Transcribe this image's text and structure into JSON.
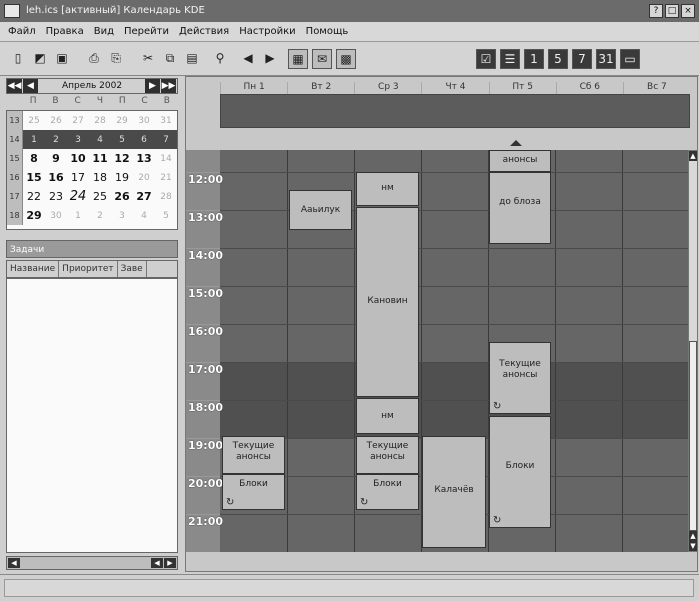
{
  "window": {
    "title": "leh.ics [активный]   Календарь KDE",
    "controls": [
      "?",
      "□",
      "×"
    ]
  },
  "menu": [
    "Файл",
    "Правка",
    "Вид",
    "Перейти",
    "Действия",
    "Настройки",
    "Помощь"
  ],
  "toolbar": {
    "icons": [
      "new-icon",
      "open-icon",
      "save-icon",
      "print-icon",
      "print-preview-icon",
      "cut-icon",
      "copy-icon",
      "paste-icon",
      "find-icon",
      "back-icon",
      "forward-icon",
      "today-icon",
      "mail-icon",
      "calendar-icon",
      "todo-view-icon",
      "list-view-icon",
      "day-view-icon",
      "week-view-icon",
      "week7-view-icon",
      "month-view-icon",
      "journal-view-icon"
    ]
  },
  "navigator": {
    "month": "Апрель 2002",
    "weekdays": [
      "П",
      "В",
      "С",
      "Ч",
      "П",
      "С",
      "В"
    ],
    "weeks": [
      {
        "num": "13",
        "days": [
          "25",
          "26",
          "27",
          "28",
          "29",
          "30",
          "31"
        ]
      },
      {
        "num": "14",
        "days": [
          "1",
          "2",
          "3",
          "4",
          "5",
          "6",
          "7"
        ]
      },
      {
        "num": "15",
        "days": [
          "8",
          "9",
          "10",
          "11",
          "12",
          "13",
          "14"
        ]
      },
      {
        "num": "16",
        "days": [
          "15",
          "16",
          "17",
          "18",
          "19",
          "20",
          "21"
        ]
      },
      {
        "num": "17",
        "days": [
          "22",
          "23",
          "24",
          "25",
          "26",
          "27",
          "28"
        ]
      },
      {
        "num": "18",
        "days": [
          "29",
          "30",
          "1",
          "2",
          "3",
          "4",
          "5"
        ]
      }
    ]
  },
  "tasks": {
    "header": "Задачи",
    "columns": [
      "Название",
      "Приоритет",
      "Заве"
    ]
  },
  "agenda": {
    "days": [
      "Пн 1",
      "Вт 2",
      "Ср 3",
      "Чт 4",
      "Пт 5",
      "Сб 6",
      "Вс 7"
    ],
    "hours": [
      "12:00",
      "13:00",
      "14:00",
      "15:00",
      "16:00",
      "17:00",
      "18:00",
      "19:00",
      "20:00",
      "21:00"
    ],
    "events": [
      {
        "label": "анонсы"
      },
      {
        "label": "нм"
      },
      {
        "label": "до блоза"
      },
      {
        "label": "Ааьилук"
      },
      {
        "label": "Кановин"
      },
      {
        "label": "Текущие анонсы"
      },
      {
        "label": "нм"
      },
      {
        "label": "Текущие анонсы"
      },
      {
        "label": "Текущие анонсы"
      },
      {
        "label": "Блоки"
      },
      {
        "label": "Блоки"
      },
      {
        "label": "Калачёв"
      },
      {
        "label": "Блоки"
      }
    ]
  }
}
